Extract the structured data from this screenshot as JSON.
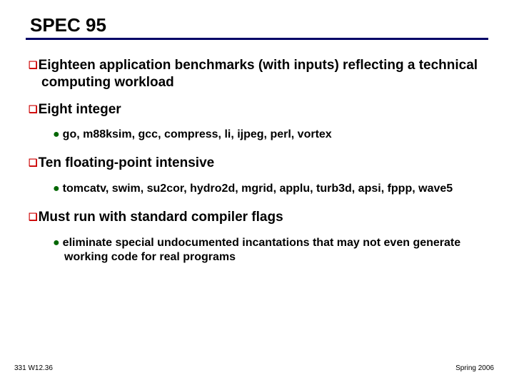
{
  "title": "SPEC 95",
  "bullets": {
    "b1": "Eighteen application benchmarks (with inputs) reflecting a technical computing workload",
    "b2": "Eight integer",
    "b2a": "go, m88ksim, gcc, compress, li, ijpeg, perl, vortex",
    "b3": "Ten floating-point intensive",
    "b3a": "tomcatv, swim, su2cor, hydro2d, mgrid, applu, turb3d, apsi, fppp, wave5",
    "b4": "Must run with standard compiler flags",
    "b4a": "eliminate special undocumented incantations that may not even generate working code for real programs"
  },
  "footer": {
    "left": "331 W12.36",
    "right": "Spring 2006"
  }
}
